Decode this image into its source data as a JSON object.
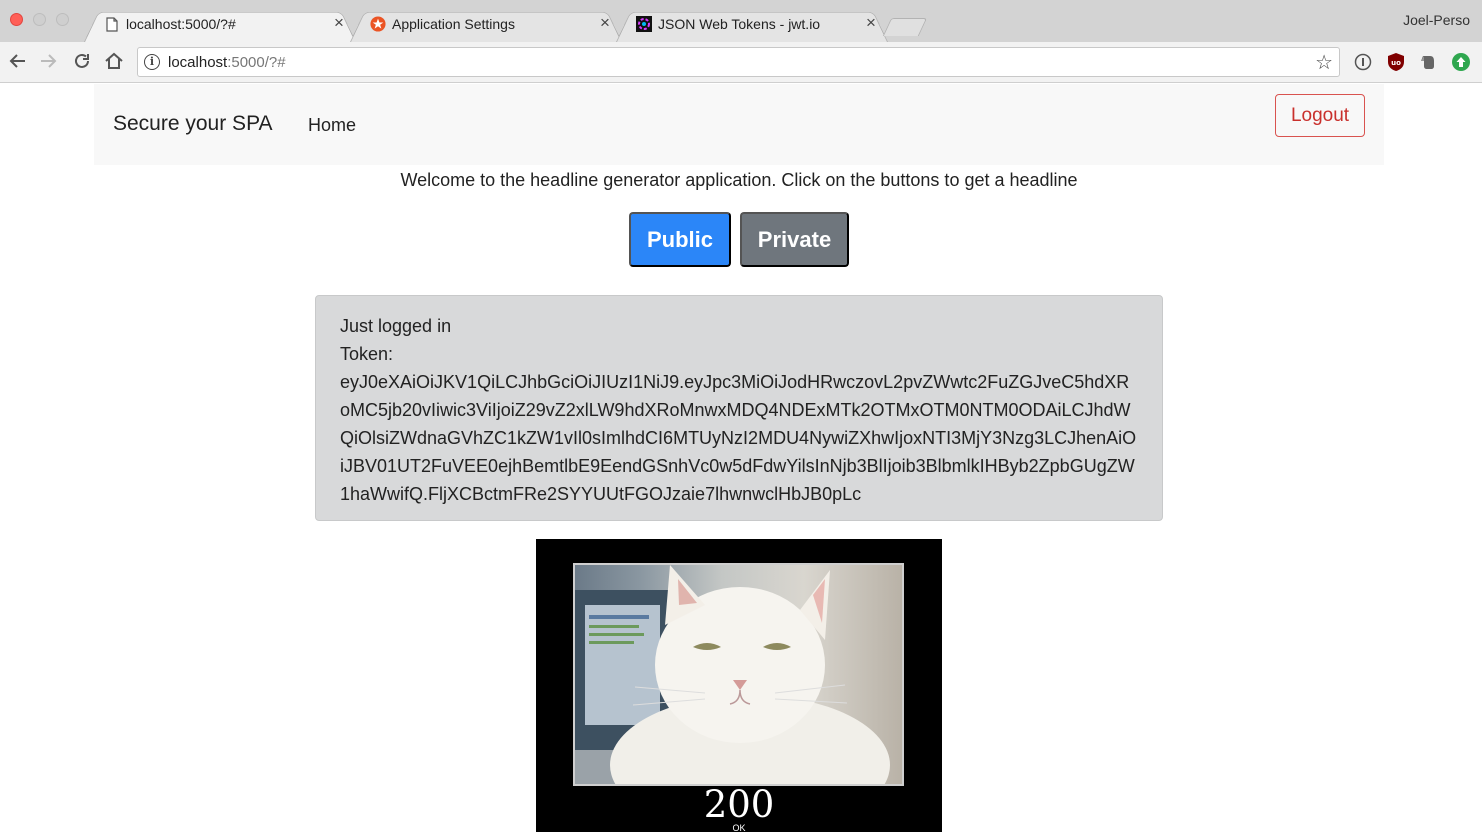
{
  "browser": {
    "tabs": [
      {
        "title": "localhost:5000/?#",
        "active": true,
        "icon": "page-icon"
      },
      {
        "title": "Application Settings",
        "active": false,
        "icon": "auth0-icon"
      },
      {
        "title": "JSON Web Tokens - jwt.io",
        "active": false,
        "icon": "jwt-icon"
      }
    ],
    "close_glyph": "×",
    "profile": "Joel-Perso",
    "url_host": "localhost",
    "url_rest": ":5000/?#"
  },
  "navbar": {
    "brand": "Secure your SPA",
    "home": "Home",
    "logout": "Logout"
  },
  "main": {
    "welcome": "Welcome to the headline generator application. Click on the buttons to get a headline",
    "public_button": "Public",
    "private_button": "Private",
    "status": "Just logged in",
    "token_label": "Token:",
    "token": "eyJ0eXAiOiJKV1QiLCJhbGciOiJIUzI1NiJ9.eyJpc3MiOiJodHRwczovL2pvZWwtc2FuZGJveC5hdXRoMC5jb20vIiwic3ViIjoiZ29vZ2xlLW9hdXRoMnwxMDQ4NDExMTk2OTMxOTM0NTM0ODAiLCJhdWQiOlsiZWdnaGVhZC1kZW1vIl0sImlhdCI6MTUyNzI2MDU4NywiZXhwIjoxNTI3MjY3Nzg3LCJhenAiOiJBV01UT2FuVEE0ejhBemtlbE9EendGSnhVc0w5dFdwYilsInNjb3BlIjoib3BlbmlkIHByb2ZpbGUgZW1haWwifQ.FljXCBctmFRe2SYYUUtFGOJzaie7lhwnwclHbJB0pLc"
  },
  "meme": {
    "caption": "200",
    "subcaption": "OK"
  },
  "colors": {
    "primary": "#2b86f8",
    "secondary": "#6f767d",
    "danger": "#d9534f"
  }
}
